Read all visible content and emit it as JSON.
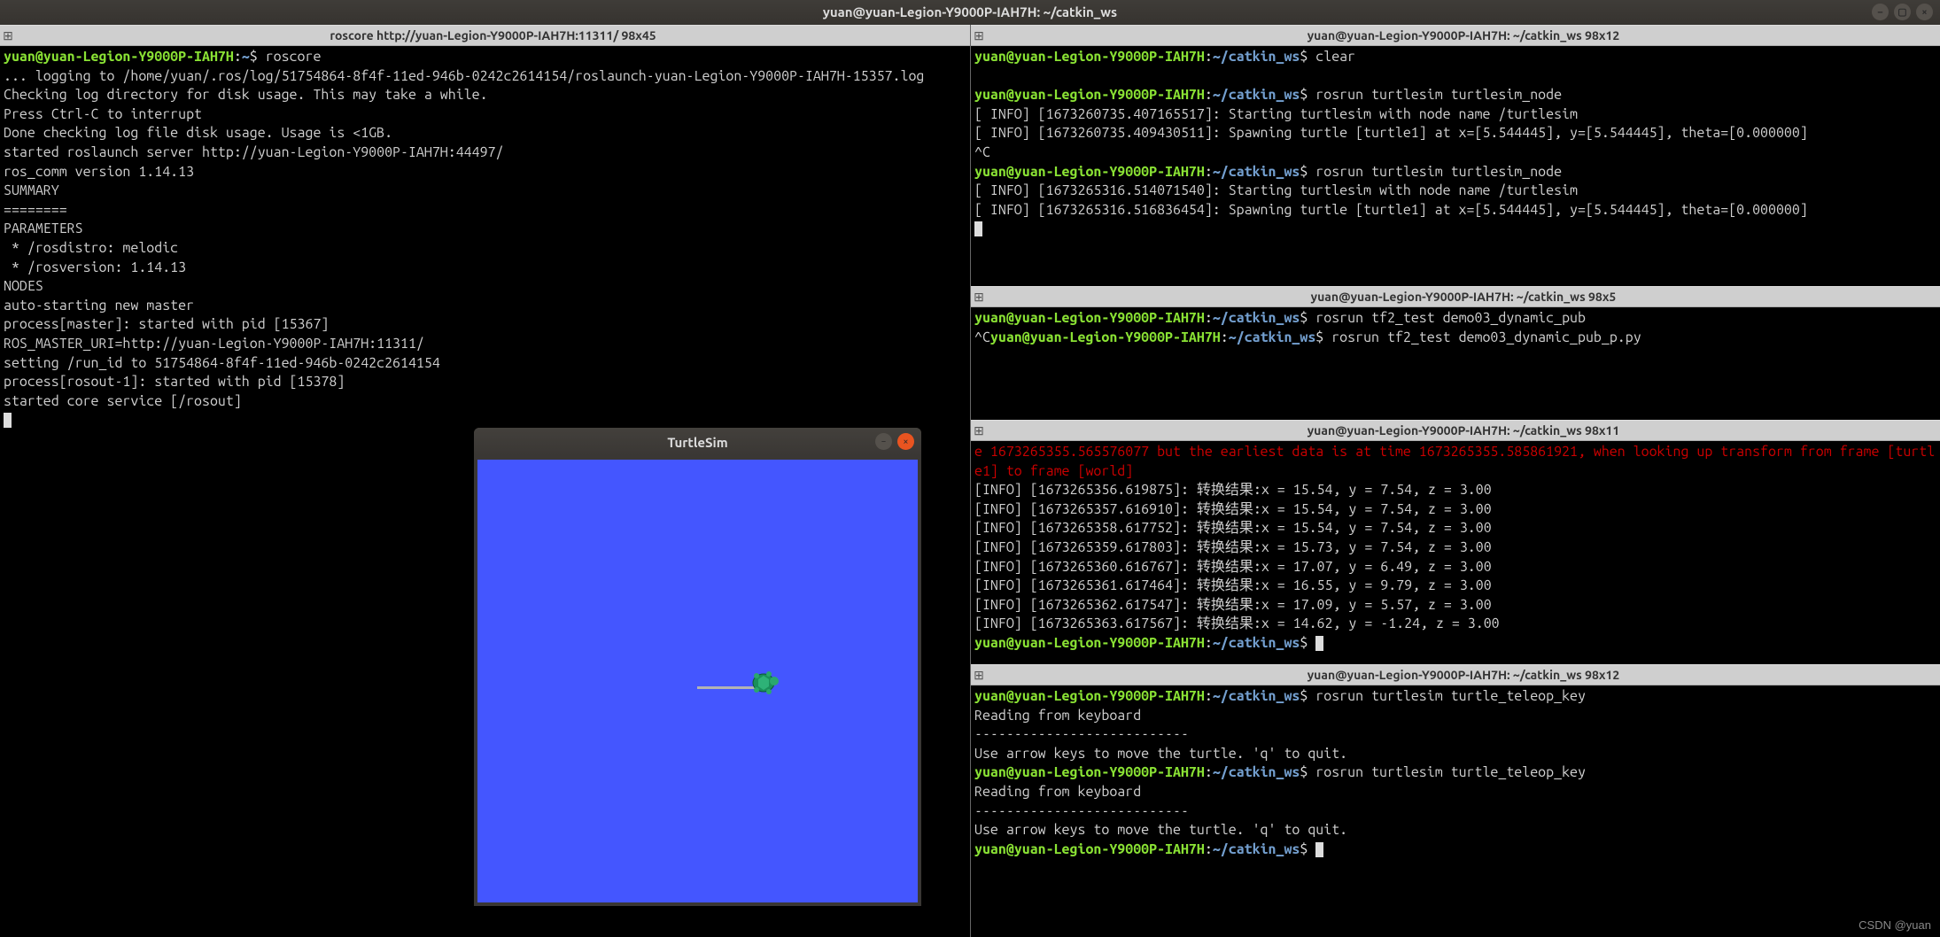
{
  "main_title": "yuan@yuan-Legion-Y9000P-IAH7H: ~/catkin_ws",
  "watermark": "CSDN @yuan",
  "prompt": {
    "user": "yuan@yuan-Legion-Y9000P-IAH7H",
    "path_home": "~",
    "path_ws": "~/catkin_ws",
    "sep": ":",
    "dollar": "$"
  },
  "left_pane": {
    "title": "roscore http://yuan-Legion-Y9000P-IAH7H:11311/ 98x45",
    "cmd": " roscore",
    "lines": [
      "... logging to /home/yuan/.ros/log/51754864-8f4f-11ed-946b-0242c2614154/roslaunch-yuan-Legion-Y9000P-IAH7H-15357.log",
      "Checking log directory for disk usage. This may take a while.",
      "Press Ctrl-C to interrupt",
      "Done checking log file disk usage. Usage is <1GB.",
      "",
      "started roslaunch server http://yuan-Legion-Y9000P-IAH7H:44497/",
      "ros_comm version 1.14.13",
      "",
      "",
      "SUMMARY",
      "========",
      "",
      "PARAMETERS",
      " * /rosdistro: melodic",
      " * /rosversion: 1.14.13",
      "",
      "NODES",
      "",
      "auto-starting new master",
      "process[master]: started with pid [15367]",
      "ROS_MASTER_URI=http://yuan-Legion-Y9000P-IAH7H:11311/",
      "",
      "setting /run_id to 51754864-8f4f-11ed-946b-0242c2614154",
      "process[rosout-1]: started with pid [15378]",
      "started core service [/rosout]"
    ]
  },
  "r1": {
    "title": "yuan@yuan-Legion-Y9000P-IAH7H: ~/catkin_ws 98x12",
    "cmd1": " clear",
    "cmd2": " rosrun turtlesim turtlesim_node",
    "cmd3": " rosrun turtlesim turtlesim_node",
    "info1": "[ INFO] [1673260735.407165517]: Starting turtlesim with node name /turtlesim",
    "info2": "[ INFO] [1673260735.409430511]: Spawning turtle [turtle1] at x=[5.544445], y=[5.544445], theta=[0.000000]",
    "ctrl_c": "^C",
    "info3": "[ INFO] [1673265316.514071540]: Starting turtlesim with node name /turtlesim",
    "info4": "[ INFO] [1673265316.516836454]: Spawning turtle [turtle1] at x=[5.544445], y=[5.544445], theta=[0.000000]"
  },
  "r2": {
    "title": "yuan@yuan-Legion-Y9000P-IAH7H: ~/catkin_ws 98x5",
    "cmd1": " rosrun tf2_test demo03_dynamic_pub",
    "ctrl_c": "^C",
    "cmd2": " rosrun tf2_test demo03_dynamic_pub_p.py"
  },
  "r3": {
    "title": "yuan@yuan-Legion-Y9000P-IAH7H: ~/catkin_ws 98x11",
    "err": "e 1673265355.565576077 but the earliest data is at time 1673265355.585861921, when looking up transform from frame [turtle1] to frame [world]",
    "rows": [
      "[INFO] [1673265356.619875]: 转换结果:x = 15.54, y = 7.54, z = 3.00",
      "[INFO] [1673265357.616910]: 转换结果:x = 15.54, y = 7.54, z = 3.00",
      "[INFO] [1673265358.617752]: 转换结果:x = 15.54, y = 7.54, z = 3.00",
      "[INFO] [1673265359.617803]: 转换结果:x = 15.73, y = 7.54, z = 3.00",
      "[INFO] [1673265360.616767]: 转换结果:x = 17.07, y = 6.49, z = 3.00",
      "[INFO] [1673265361.617464]: 转换结果:x = 16.55, y = 9.79, z = 3.00",
      "[INFO] [1673265362.617547]: 转换结果:x = 17.09, y = 5.57, z = 3.00",
      "[INFO] [1673265363.617567]: 转换结果:x = 14.62, y = -1.24, z = 3.00"
    ]
  },
  "r4": {
    "title": "yuan@yuan-Legion-Y9000P-IAH7H: ~/catkin_ws 98x12",
    "cmd": " rosrun turtlesim turtle_teleop_key",
    "reading": "Reading from keyboard",
    "dashes": "---------------------------",
    "hint": "Use arrow keys to move the turtle. 'q' to quit."
  },
  "turtlesim": {
    "title": "TurtleSim"
  }
}
